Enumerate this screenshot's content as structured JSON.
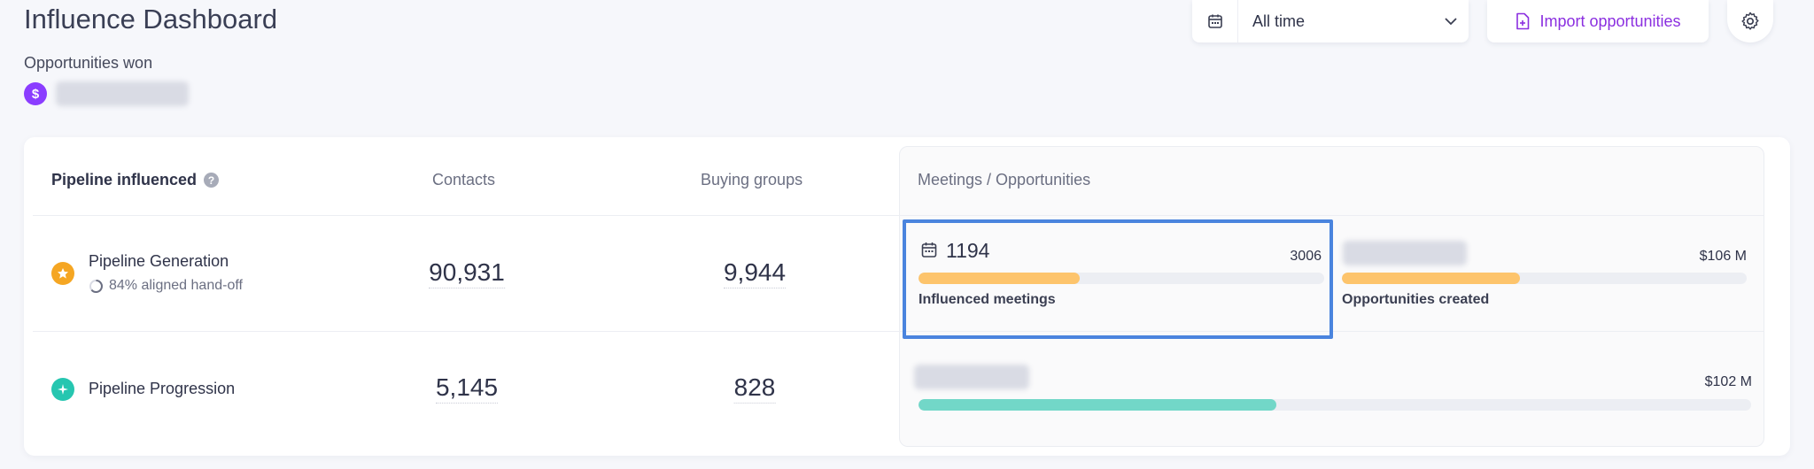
{
  "header": {
    "title": "Influence Dashboard",
    "won_label": "Opportunities won",
    "won_coin": "$",
    "date_filter": "All time",
    "import_label": "Import opportunities"
  },
  "table": {
    "headers": {
      "pipeline": "Pipeline influenced",
      "contacts": "Contacts",
      "buying_groups": "Buying groups",
      "meetings": "Meetings / Opportunities"
    },
    "rows": [
      {
        "name": "Pipeline Generation",
        "sub": "84% aligned hand-off",
        "contacts": "90,931",
        "buying_groups": "9,944",
        "meetings": {
          "value": "1194",
          "total": "3006",
          "progress": 0.397,
          "label": "Influenced meetings"
        },
        "opportunities": {
          "amount": "$106 M",
          "progress": 0.44,
          "label": "Opportunities created"
        }
      },
      {
        "name": "Pipeline Progression",
        "contacts": "5,145",
        "buying_groups": "828",
        "opportunities": {
          "amount": "$102 M",
          "progress": 0.43
        }
      }
    ]
  },
  "colors": {
    "accent_purple": "#8b2fe0",
    "coin_purple": "#8b3dff",
    "star_orange": "#f5a623",
    "teal": "#26c6b0",
    "bar_orange": "#fdc46c",
    "bar_teal": "#72d7c8",
    "highlight_blue": "#4a84de"
  },
  "icons": {
    "date": "calendar-icon",
    "dropdown": "chevron-down-icon",
    "import": "file-plus-icon",
    "settings": "gear-icon",
    "help": "help-icon",
    "generation": "star-icon",
    "progression": "sparkle-icon",
    "aligned": "progress-ring-icon",
    "meetings": "calendar-icon"
  }
}
